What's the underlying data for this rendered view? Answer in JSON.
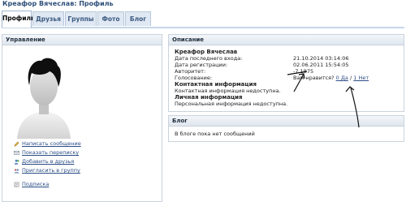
{
  "window": {
    "title": "Креафор Вячеслав: Профиль"
  },
  "tabs": [
    {
      "label": "Профиль",
      "active": true
    },
    {
      "label": "Друзья"
    },
    {
      "label": "Группы"
    },
    {
      "label": "Фото"
    },
    {
      "label": "Блог"
    }
  ],
  "left_panel": {
    "title": "Управление",
    "actions": [
      {
        "label": "Написать сообщение",
        "icon": "pencil-icon"
      },
      {
        "label": "Показать переписку",
        "icon": "mail-icon"
      },
      {
        "label": "Добавить в друзья",
        "icon": "add-friend-icon"
      },
      {
        "label": "Пригласить в группу",
        "icon": "group-invite-icon"
      },
      {
        "label": "Подписка",
        "icon": "subscribe-icon"
      }
    ]
  },
  "description": {
    "title": "Описание",
    "name": "Креафор Вячеслав",
    "last_login_label": "Дата последнего входа:",
    "last_login_value": "21.10.2014 03:14:06",
    "registered_label": "Дата регистрации:",
    "registered_value": "02.06.2011 15:54:05",
    "authority_label": "Авторитет:",
    "authority_value": "-7.1875",
    "vote_label": "Голосование:",
    "vote_question": "Вам нравится?",
    "vote_yes": "0 Да",
    "vote_sep": "/",
    "vote_no": "1 Нет",
    "contact_heading": "Контактная информация",
    "contact_text": "Контактная информация недоступна.",
    "personal_heading": "Личная информация",
    "personal_text": "Персональная информация недоступна."
  },
  "blog": {
    "title": "Блог",
    "empty_text": "В блоге пока нет сообщений"
  },
  "colors": {
    "link": "#2b4d86",
    "tab_bg": "#dfe8f3",
    "panel_border": "#c9d3de"
  }
}
